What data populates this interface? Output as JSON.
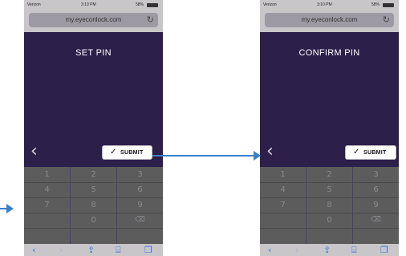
{
  "status_bar": {
    "carrier": "Verizon",
    "time": "3:10 PM",
    "battery": "58%"
  },
  "browser": {
    "url": "my.eyeconlock.com"
  },
  "screens": {
    "set": {
      "title": "SET PIN",
      "submit": "SUBMIT"
    },
    "confirm": {
      "title": "CONFIRM PIN",
      "submit": "SUBMIT"
    }
  },
  "keypad": {
    "keys": [
      "1",
      "2",
      "3",
      "4",
      "5",
      "6",
      "7",
      "8",
      "9",
      "",
      "0",
      "⌫"
    ]
  },
  "colors": {
    "background_purple": "#2c1f4a",
    "keypad_gray": "#5d5c5d",
    "arrow_blue": "#3a7fc9",
    "toolbar_blue": "#3c6fe0"
  },
  "icons": {
    "back": "chevron-left-icon",
    "check": "check-icon",
    "reload": "reload-icon",
    "delete": "backspace-icon"
  }
}
